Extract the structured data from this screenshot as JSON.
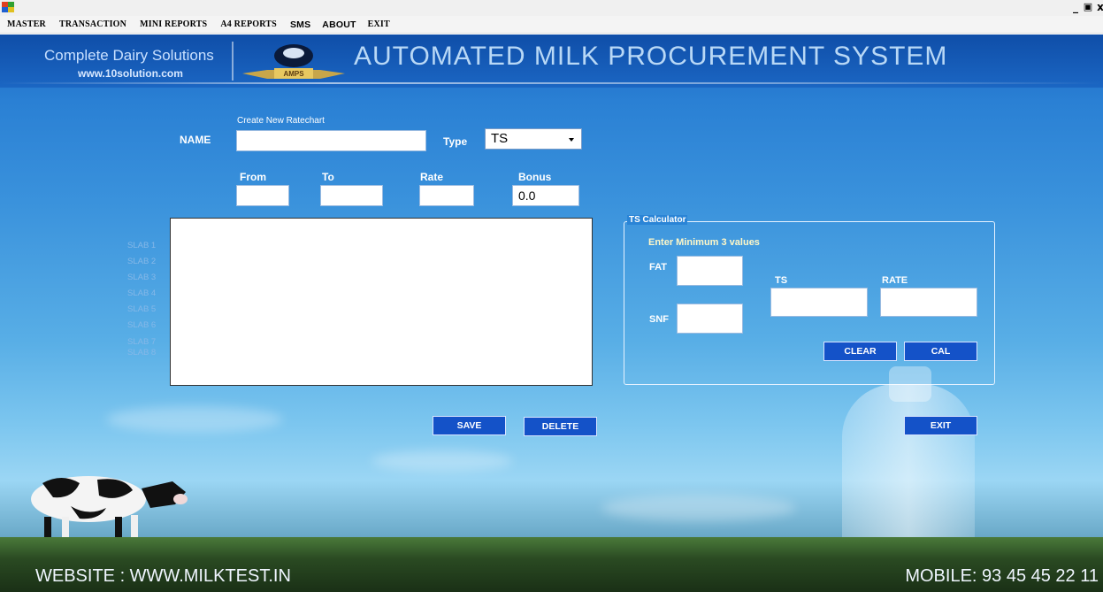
{
  "window": {
    "controls": [
      "_",
      "ȅ",
      "x"
    ]
  },
  "menu": [
    "MASTER",
    "TRANSACTION",
    "MINI REPORTS",
    "A4 REPORTS",
    "SMS",
    "ABOUT",
    "EXIT"
  ],
  "banner": {
    "company": "Complete Dairy Solutions",
    "website_small": "www.10solution.com",
    "logo_text": "AMPS",
    "title": "AUTOMATED MILK PROCUREMENT SYSTEM"
  },
  "form": {
    "section_title": "Create New Ratechart",
    "name_label": "NAME",
    "name_value": "",
    "type_label": "Type",
    "type_value": "TS",
    "from_label": "From",
    "to_label": "To",
    "rate_label": "Rate",
    "bonus_label": "Bonus",
    "from_value": "",
    "to_value": "",
    "rate_value": "",
    "bonus_value": "0.0"
  },
  "slabs": [
    "SLAB 1",
    "SLAB 2",
    "SLAB 3",
    "SLAB 4",
    "SLAB 5",
    "SLAB 6",
    "SLAB 7",
    "SLAB 8"
  ],
  "calculator": {
    "title": "TS Calculator",
    "hint": "Enter Minimum 3 values",
    "fat_label": "FAT",
    "snf_label": "SNF",
    "ts_label": "TS",
    "rate_label": "RATE",
    "clear_button": "CLEAR",
    "cal_button": "CAL"
  },
  "actions": {
    "save": "SAVE",
    "delete": "DELETE",
    "exit": "EXIT"
  },
  "footer": {
    "website": "WEBSITE : WWW.MILKTEST.IN",
    "mobile": "MOBILE: 93 45 45 22 11"
  }
}
